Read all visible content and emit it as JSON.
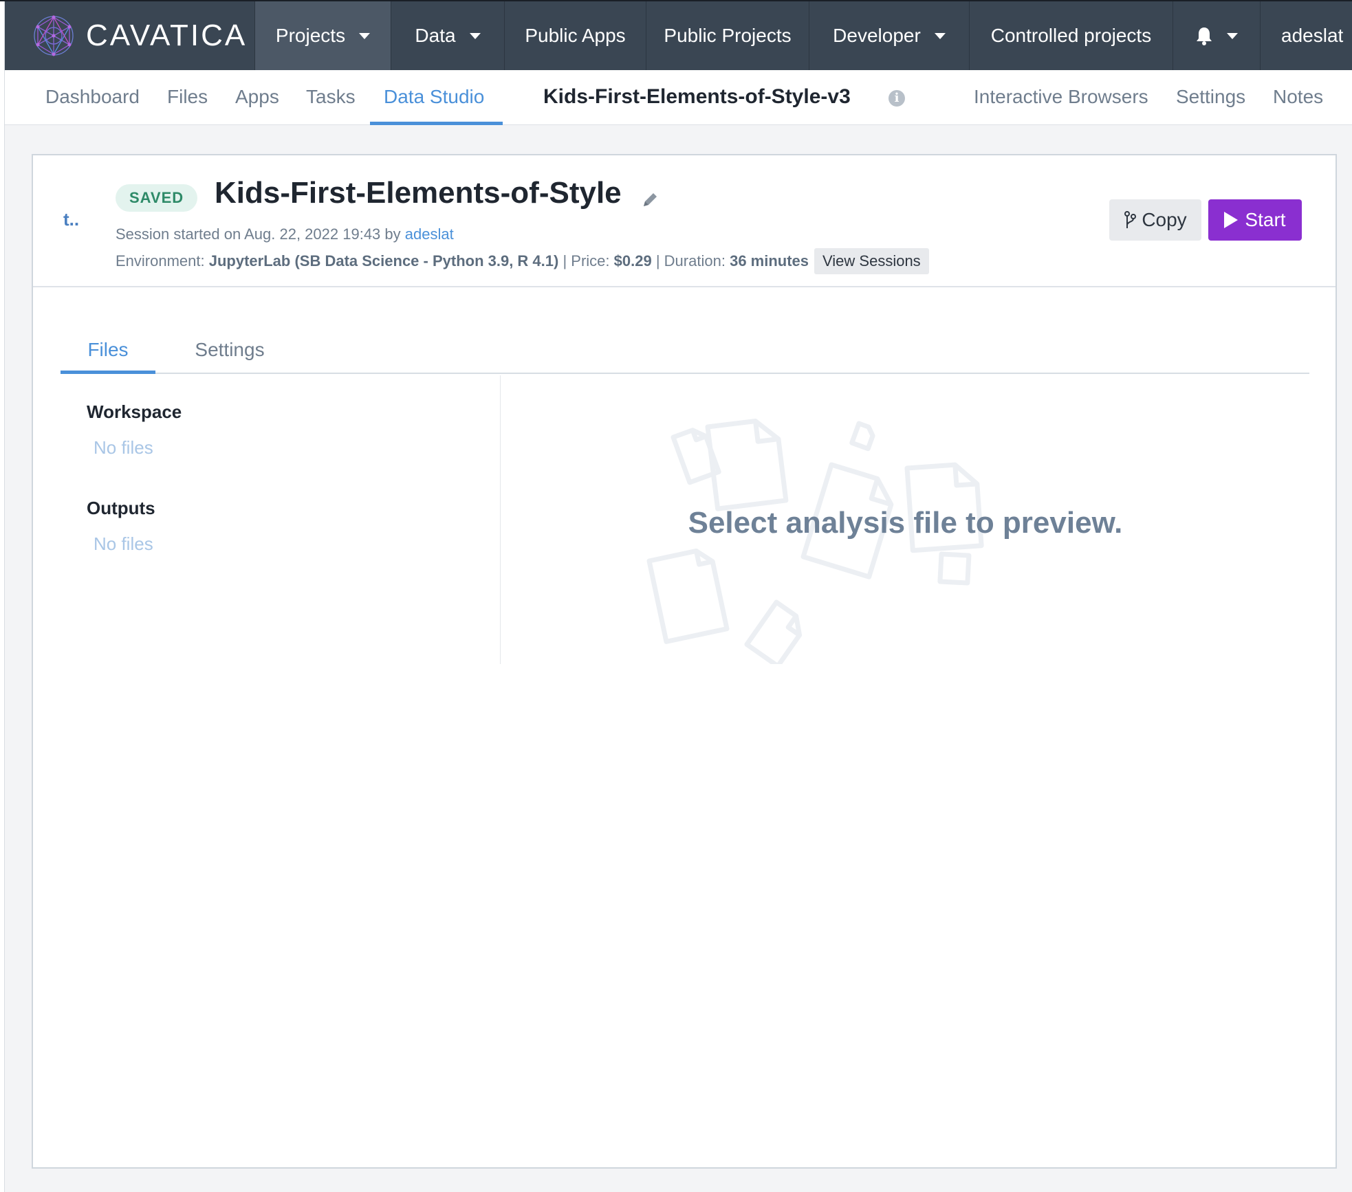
{
  "topnav": {
    "brand": "CAVATICA",
    "items": [
      {
        "label": "Projects",
        "has_caret": true,
        "active": true
      },
      {
        "label": "Data",
        "has_caret": true
      },
      {
        "label": "Public Apps"
      },
      {
        "label": "Public Projects"
      },
      {
        "label": "Developer",
        "has_caret": true
      },
      {
        "label": "Controlled projects"
      }
    ],
    "user": "adeslat"
  },
  "subnav": {
    "tabs": [
      "Dashboard",
      "Files",
      "Apps",
      "Tasks",
      "Data Studio"
    ],
    "active_tab": "Data Studio",
    "project_title": "Kids-First-Elements-of-Style-v3",
    "right_links": [
      "Interactive Browsers",
      "Settings",
      "Notes"
    ]
  },
  "session": {
    "back_label": "t..",
    "status": "SAVED",
    "title": "Kids-First-Elements-of-Style",
    "started_prefix": "Session started on Aug. 22, 2022 19:43 by",
    "user": "adeslat",
    "env_label": "Environment:",
    "env_value": "JupyterLab (SB Data Science - Python 3.9, R 4.1)",
    "price_label": "| Price:",
    "price_value": "$0.29",
    "duration_label": "| Duration:",
    "duration_value": "36 minutes",
    "view_sessions": "View Sessions",
    "copy_label": "Copy",
    "start_label": "Start"
  },
  "panel": {
    "tabs": [
      "Files",
      "Settings"
    ],
    "active_tab": "Files",
    "workspace_label": "Workspace",
    "workspace_empty": "No files",
    "outputs_label": "Outputs",
    "outputs_empty": "No files",
    "preview_message": "Select analysis file to preview."
  },
  "colors": {
    "topnav_bg": "#3a4653",
    "accent": "#4a90d9",
    "start_button": "#8a2fd0",
    "saved_badge": "#2e8a68"
  }
}
